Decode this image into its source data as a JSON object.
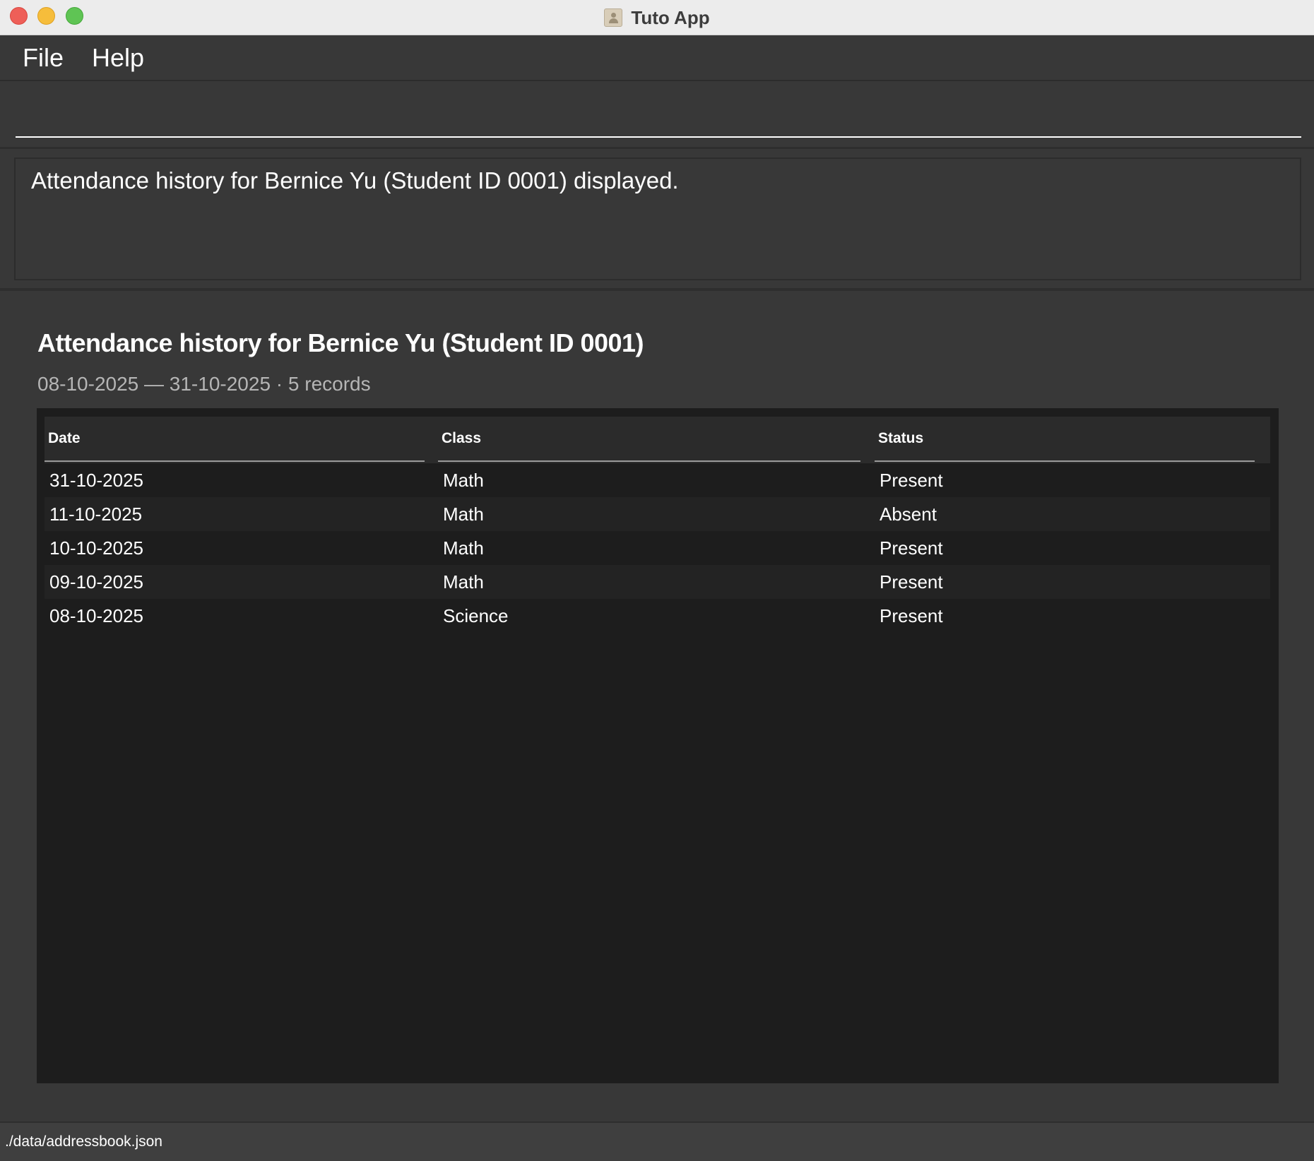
{
  "window": {
    "title": "Tuto App",
    "app_icon": "address-book-icon"
  },
  "menu": {
    "items": [
      {
        "label": "File"
      },
      {
        "label": "Help"
      }
    ]
  },
  "command": {
    "value": "",
    "placeholder": ""
  },
  "result": {
    "message": "Attendance history for Bernice Yu (Student ID 0001) displayed."
  },
  "attendance": {
    "heading": "Attendance history for Bernice Yu (Student ID 0001)",
    "subtitle": "08-10-2025 — 31-10-2025 · 5 records",
    "columns": [
      "Date",
      "Class",
      "Status"
    ],
    "rows": [
      {
        "date": "31-10-2025",
        "class": "Math",
        "status": "Present"
      },
      {
        "date": "11-10-2025",
        "class": "Math",
        "status": "Absent"
      },
      {
        "date": "10-10-2025",
        "class": "Math",
        "status": "Present"
      },
      {
        "date": "09-10-2025",
        "class": "Math",
        "status": "Present"
      },
      {
        "date": "08-10-2025",
        "class": "Science",
        "status": "Present"
      }
    ]
  },
  "status_bar": {
    "path": "./data/addressbook.json"
  },
  "colors": {
    "background": "#383838",
    "table_background": "#1d1d1d",
    "close": "#ee5f58",
    "minimize": "#f6bd3b",
    "maximize": "#5fc454"
  }
}
